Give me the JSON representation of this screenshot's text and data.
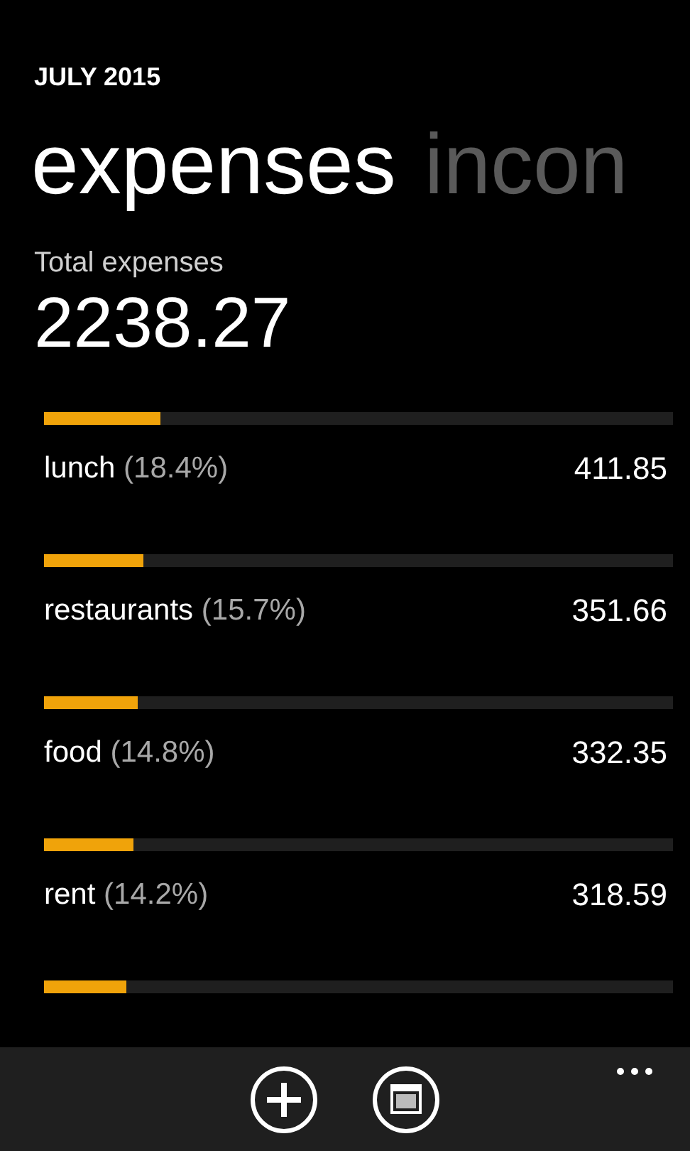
{
  "header": {
    "period": "JULY 2015"
  },
  "pivot": [
    {
      "label": "expenses",
      "selected": true
    },
    {
      "label": "incon",
      "selected": false
    }
  ],
  "summary": {
    "label": "Total expenses",
    "total": "2238.27"
  },
  "categories": [
    {
      "name": "lunch",
      "share": "(18.4%)",
      "amount": "411.85",
      "level": 0.185
    },
    {
      "name": "restaurants",
      "share": "(15.7%)",
      "amount": "351.66",
      "level": 0.158
    },
    {
      "name": "food",
      "share": "(14.8%)",
      "amount": "332.35",
      "level": 0.149
    },
    {
      "name": "rent",
      "share": "(14.2%)",
      "amount": "318.59",
      "level": 0.142
    }
  ],
  "partial_bar": {
    "level": 0.131
  },
  "app_bar": {
    "buttons": [
      {
        "kind": "add"
      },
      {
        "kind": "calendar"
      }
    ]
  }
}
